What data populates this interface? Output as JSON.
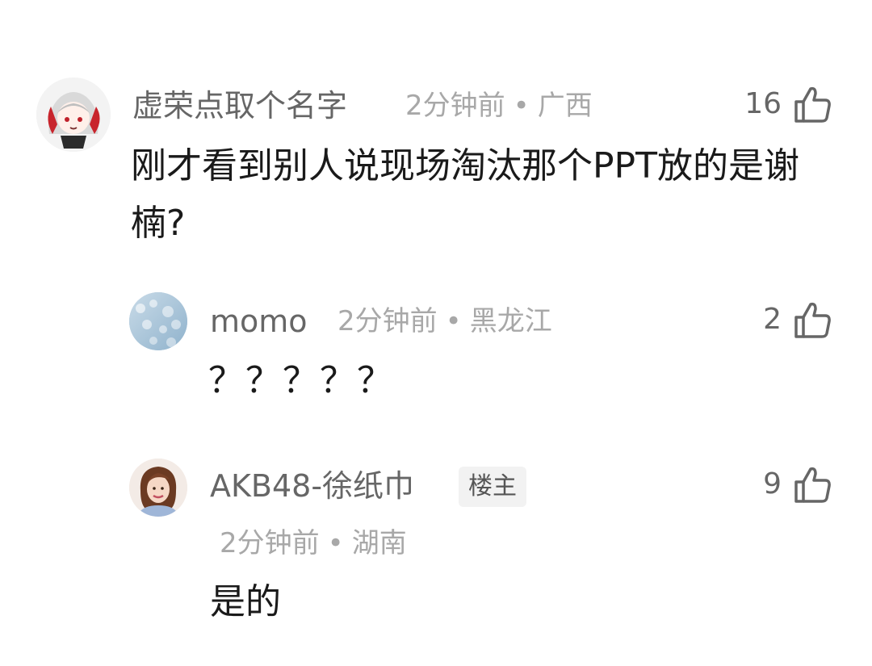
{
  "comments": [
    {
      "author": "虚荣点取个名字",
      "time": "2分钟前",
      "location": "广西",
      "likes": "16",
      "text": "刚才看到别人说现场淘汰那个PPT放的是谢楠?"
    },
    {
      "author": "momo",
      "time": "2分钟前",
      "location": "黑龙江",
      "likes": "2",
      "text": "？？？？？"
    },
    {
      "author": "AKB48-徐纸巾",
      "badge": "楼主",
      "time": "2分钟前",
      "location": "湖南",
      "likes": "9",
      "text": "是的"
    }
  ],
  "separator": "•",
  "icons": {
    "like": "thumbs-up-icon"
  }
}
